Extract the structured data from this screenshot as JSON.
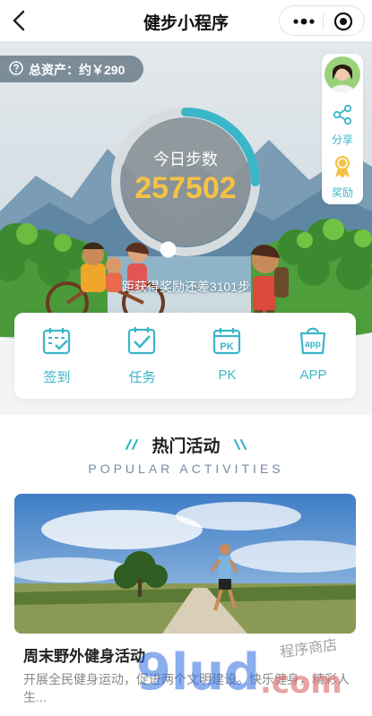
{
  "nav": {
    "title": "健步小程序"
  },
  "hero": {
    "assets_label": "总资产：约￥290",
    "today_label": "今日步数",
    "step_count": "257502",
    "progress_fraction": 0.25,
    "remaining_text": "距获得奖励还差3101步"
  },
  "side": {
    "share_label": "分享",
    "award_label": "奖励"
  },
  "menu": [
    {
      "label": "签到",
      "icon": "calendar-check-icon"
    },
    {
      "label": "任务",
      "icon": "task-check-icon"
    },
    {
      "label": "PK",
      "icon": "pk-calendar-icon"
    },
    {
      "label": "APP",
      "icon": "app-bag-icon"
    }
  ],
  "popular": {
    "title": "热门活动",
    "subtitle": "POPULAR ACTIVITIES",
    "activity": {
      "title": "周末野外健身活动",
      "desc": "开展全民健身运动，促进两个文明建设。快乐健身，精彩人生..."
    }
  },
  "watermark": {
    "brand": "9lud",
    "suffix": ".com",
    "tag": "程序商店"
  },
  "colors": {
    "accent": "#3bb6c9",
    "steps": "#f6c244",
    "ring_track": "#d7dcdf"
  }
}
